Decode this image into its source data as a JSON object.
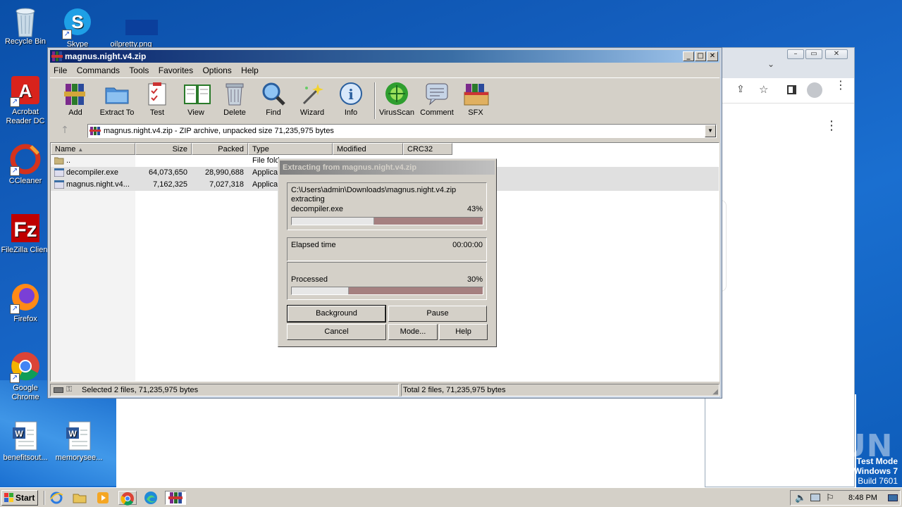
{
  "desktop": {
    "icons": [
      {
        "label": "Recycle Bin"
      },
      {
        "label": "Skype"
      },
      {
        "label": "oilpretty.png"
      },
      {
        "label": "Acrobat Reader DC"
      },
      {
        "label": "CCleaner"
      },
      {
        "label": "FileZilla Client"
      },
      {
        "label": "Firefox"
      },
      {
        "label": "Google Chrome"
      },
      {
        "label": "benefitsout..."
      },
      {
        "label": "memorysee..."
      }
    ],
    "watermark": "ANY RUN",
    "test_mode": {
      "line1": "Test Mode",
      "line2": "Windows 7",
      "line3": "Build 7601"
    }
  },
  "winrar": {
    "title": "magnus.night.v4.zip",
    "menu": [
      "File",
      "Commands",
      "Tools",
      "Favorites",
      "Options",
      "Help"
    ],
    "toolbar": [
      {
        "label": "Add",
        "icon": "add-icon"
      },
      {
        "label": "Extract To",
        "icon": "extract-icon"
      },
      {
        "label": "Test",
        "icon": "test-icon"
      },
      {
        "label": "View",
        "icon": "view-icon"
      },
      {
        "label": "Delete",
        "icon": "delete-icon"
      },
      {
        "label": "Find",
        "icon": "find-icon"
      },
      {
        "label": "Wizard",
        "icon": "wizard-icon"
      },
      {
        "label": "Info",
        "icon": "info-icon"
      },
      {
        "label": "VirusScan",
        "icon": "virusscan-icon"
      },
      {
        "label": "Comment",
        "icon": "comment-icon"
      },
      {
        "label": "SFX",
        "icon": "sfx-icon"
      }
    ],
    "address": "magnus.night.v4.zip - ZIP archive, unpacked size 71,235,975 bytes",
    "columns": [
      "Name",
      "Size",
      "Packed",
      "Type",
      "Modified",
      "CRC32"
    ],
    "rows": [
      {
        "name": "..",
        "size": "",
        "packed": "",
        "type": "File fold"
      },
      {
        "name": "decompiler.exe",
        "size": "64,073,650",
        "packed": "28,990,688",
        "type": "Applicat"
      },
      {
        "name": "magnus.night.v4...",
        "size": "7,162,325",
        "packed": "7,027,318",
        "type": "Applicat"
      }
    ],
    "status_left": "Selected 2 files, 71,235,975 bytes",
    "status_right": "Total 2 files, 71,235,975 bytes"
  },
  "dialog": {
    "title": "Extracting from magnus.night.v4.zip",
    "path": "C:\\Users\\admin\\Downloads\\magnus.night.v4.zip",
    "action": "extracting",
    "file": "decompiler.exe",
    "file_percent": "43%",
    "file_progress": 0.43,
    "elapsed_label": "Elapsed time",
    "elapsed_value": "00:00:00",
    "processed_label": "Processed",
    "processed_percent": "30%",
    "processed_progress": 0.3,
    "buttons": {
      "background": "Background",
      "pause": "Pause",
      "cancel": "Cancel",
      "mode": "Mode...",
      "help": "Help"
    }
  },
  "taskbar": {
    "start": "Start",
    "clock": "8:48 PM"
  },
  "colors": {
    "desktop": "#1560c0",
    "titlebar": "#0a246a",
    "progress_bg": "#a58080"
  }
}
